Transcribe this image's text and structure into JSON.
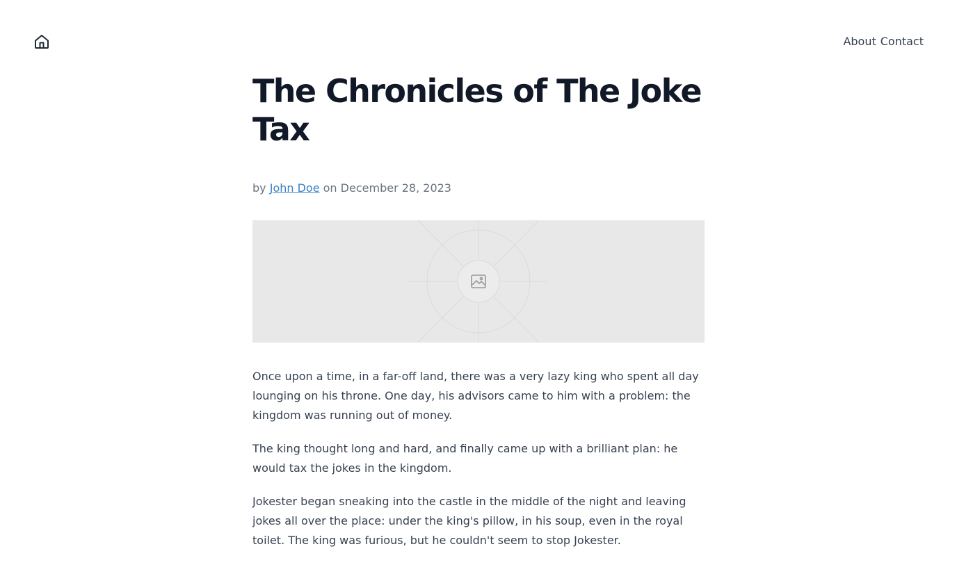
{
  "header": {
    "home_icon": "home-icon",
    "nav": [
      {
        "label": "About"
      },
      {
        "label": "Contact"
      }
    ]
  },
  "article": {
    "title": "The Chronicles of The Joke Tax",
    "byline": {
      "prefix": "by",
      "author": "John Doe",
      "middle": "on",
      "date": "December 28, 2023"
    },
    "image": {
      "icon": "image-placeholder-icon"
    },
    "paragraphs": [
      "Once upon a time, in a far-off land, there was a very lazy king who spent all day lounging on his throne. One day, his advisors came to him with a problem: the kingdom was running out of money.",
      "The king thought long and hard, and finally came up with a brilliant plan: he would tax the jokes in the kingdom.",
      "Jokester began sneaking into the castle in the middle of the night and leaving jokes all over the place: under the king's pillow, in his soup, even in the royal toilet. The king was furious, but he couldn't seem to stop Jokester."
    ]
  },
  "colors": {
    "heading": "#111827",
    "text": "#374151",
    "muted": "#6b7280",
    "link": "#3b82c4",
    "placeholder_bg": "#e8e8e8"
  }
}
